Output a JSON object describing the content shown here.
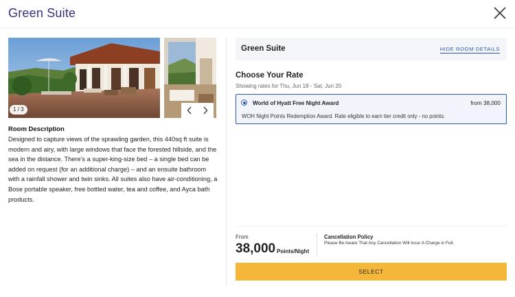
{
  "modal": {
    "title": "Green Suite",
    "close_icon": "close-icon"
  },
  "gallery": {
    "counter": "1 / 3",
    "prev_icon": "chevron-left-icon",
    "next_icon": "chevron-right-icon"
  },
  "description": {
    "title": "Room Description",
    "text": "Designed to capture views of the sprawling garden, this 440sq ft suite is modern and airy, with large windows that face the forested hillside, and the sea in the distance. There’s a super-king-size bed – a single bed can be added on request (for an additional charge) – and an ensuite bathroom with a rainfall shower and twin sinks. All suites also have air-conditioning, a Bose portable speaker, free bottled water, tea and coffee, and Ayca bath products."
  },
  "room": {
    "name": "Green Suite",
    "hide_details_label": "HIDE ROOM DETAILS"
  },
  "rates": {
    "heading": "Choose Your Rate",
    "subheading": "Showing rates for Thu, Jun 18 - Sat, Jun 20",
    "options": [
      {
        "name": "World of Hyatt Free Night Award",
        "price": "from 38,000",
        "detail": "WOH Night Points Redemption Award. Rate eligible to earn tier credit only - no points.",
        "selected": true
      }
    ]
  },
  "footer": {
    "from_label": "From",
    "price": "38,000",
    "price_unit": "Points/Night",
    "cancellation_title": "Cancellation Policy",
    "cancellation_text": "Please Be Aware That Any Cancellation Will Incur A Charge in Full.",
    "select_label": "SELECT"
  },
  "colors": {
    "title": "#34327a",
    "link": "#2b58a8",
    "select_button": "#f4b73a",
    "rate_card_bg": "#f1f4fb",
    "room_bar_bg": "#f4f5f8"
  }
}
